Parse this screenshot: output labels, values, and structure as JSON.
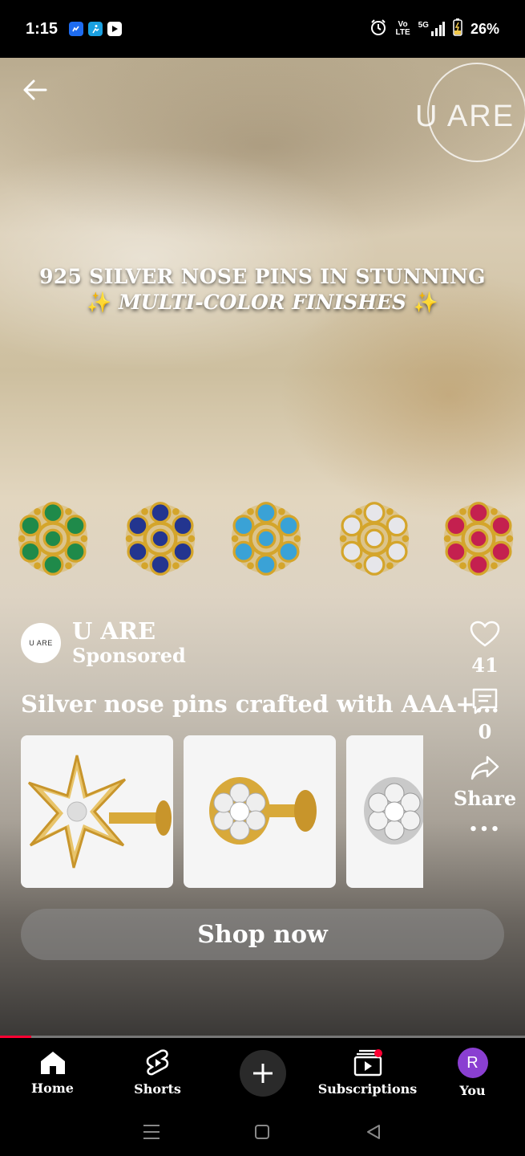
{
  "status_bar": {
    "time": "1:15",
    "battery": "26%",
    "volte_top": "Vo",
    "volte_bottom": "LTE",
    "network": "5G",
    "icons": [
      "messenger-icon",
      "fitness-icon",
      "youtube-icon",
      "alarm-icon",
      "signal-icon",
      "battery-icon"
    ]
  },
  "video": {
    "watermark": "U ARE",
    "headline_line1": "925 SILVER NOSE PINS IN STUNNING",
    "headline_line2": "MULTI-COLOR FINISHES",
    "sparkle": "✨",
    "pin_colors": [
      "#1f8a4a",
      "#23358f",
      "#3aa2d6",
      "#e6e6ea",
      "#c4204f"
    ],
    "gold": "#d4a52b"
  },
  "channel": {
    "avatar_text": "U ARE",
    "name": "U ARE",
    "sponsored": "Sponsored"
  },
  "caption": "Silver nose pins crafted with AAA+...",
  "actions": {
    "likes": "41",
    "comments": "0",
    "share": "Share",
    "more": "•••"
  },
  "shop_button": "Shop now",
  "progress_fraction": 0.06,
  "nav": {
    "home": "Home",
    "shorts": "Shorts",
    "subscriptions": "Subscriptions",
    "you": "You",
    "you_initial": "R"
  },
  "colors": {
    "accent": "#ff0033",
    "you_avatar": "#8a3fd1"
  }
}
